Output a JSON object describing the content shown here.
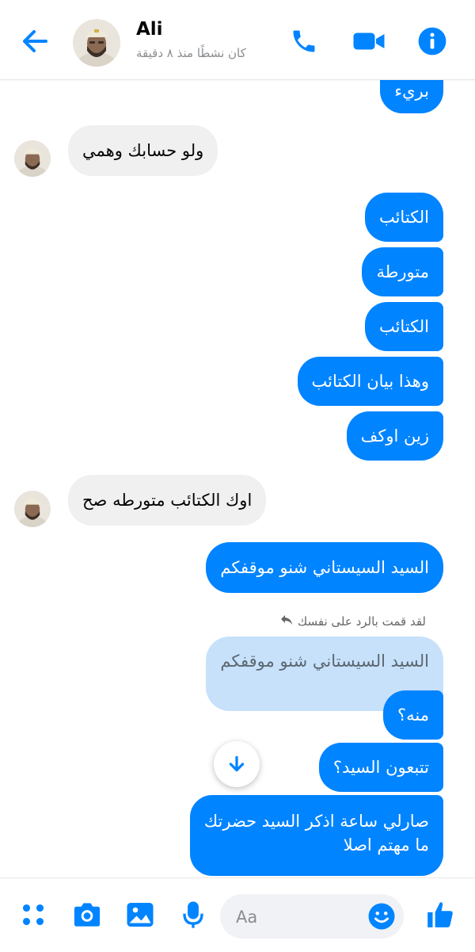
{
  "header": {
    "name": "Ali",
    "status": "كان نشطًا منذ ٨ دقيقة",
    "icons": [
      "back-arrow-icon",
      "phone-icon",
      "video-camera-icon",
      "info-icon"
    ],
    "accent": "#0084ff"
  },
  "messages": [
    {
      "direction": "out",
      "text": "بريء"
    },
    {
      "direction": "in",
      "text": "ولو حسابك وهمي"
    },
    {
      "direction": "out",
      "text": "الكتائب"
    },
    {
      "direction": "out",
      "text": "متورطة"
    },
    {
      "direction": "out",
      "text": "الكتائب"
    },
    {
      "direction": "out",
      "text": "وهذا بيان الكتائب"
    },
    {
      "direction": "out",
      "text": "زين اوكف"
    },
    {
      "direction": "in",
      "text": "اوك الكتائب متورطه صح"
    },
    {
      "direction": "out",
      "text": "السيد السيستاني شنو موقفكم"
    },
    {
      "direction": "out",
      "text": "السيد السيستاني شنو موقفكم",
      "quoted": true
    },
    {
      "direction": "out",
      "text": "منه؟"
    },
    {
      "direction": "out",
      "text": "تتبعون السيد؟"
    },
    {
      "direction": "out",
      "lines": [
        "صارلي ساعة اذكر السيد حضرتك",
        "ما مهتم اصلا"
      ]
    }
  ],
  "reply_note": "لقد قمت بالرد على نفسك",
  "composer": {
    "placeholder": "Aa",
    "icons": [
      "apps-grid-icon",
      "camera-icon",
      "gallery-icon",
      "microphone-icon",
      "emoji-icon",
      "thumbs-up-icon"
    ]
  },
  "colors": {
    "outgoing": "#0084ff",
    "incoming": "#f0f0f0",
    "quoted": "#c7e1fb"
  }
}
